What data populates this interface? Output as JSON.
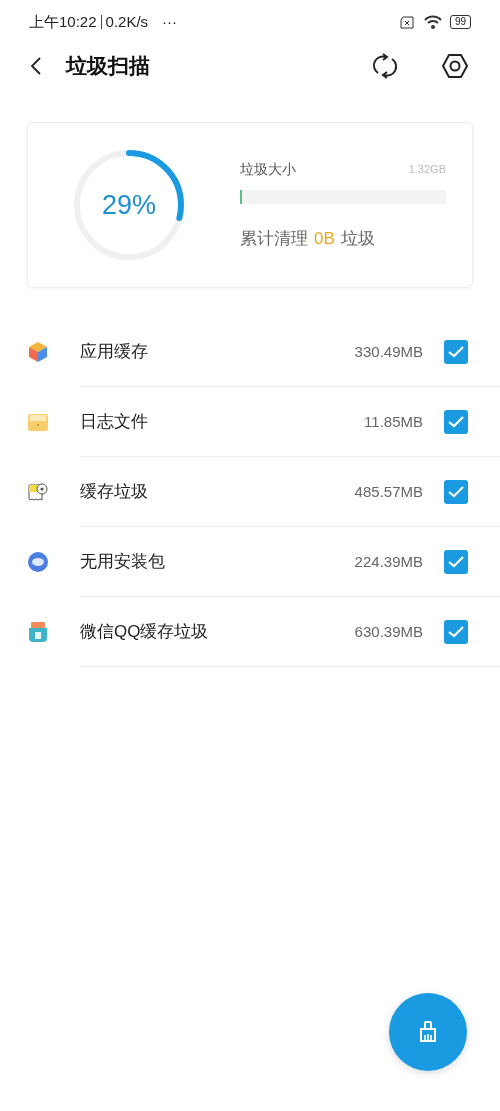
{
  "status_bar": {
    "time": "上午10:22",
    "speed": "0.2K/s",
    "more": "···",
    "battery": "99"
  },
  "header": {
    "title": "垃圾扫描"
  },
  "summary": {
    "percent": "29%",
    "level": 0.29,
    "size_label": "垃圾大小",
    "size": "1.32GB",
    "bar": {
      "level": 0.01
    },
    "cleaned_prefix": "累计清理",
    "cleaned": "0B",
    "cleaned_suffix": "垃圾"
  },
  "items": [
    {
      "kind": "app",
      "label": "应用缓存",
      "size": "330.49MB",
      "checked": true
    },
    {
      "kind": "log",
      "label": "日志文件",
      "size": "11.85MB",
      "checked": true
    },
    {
      "kind": "cache",
      "label": "缓存垃圾",
      "size": "485.57MB",
      "checked": true
    },
    {
      "kind": "apk",
      "label": "无用安装包",
      "size": "224.39MB",
      "checked": true
    },
    {
      "kind": "chat",
      "label": "微信QQ缓存垃圾",
      "size": "630.39MB",
      "checked": true
    }
  ]
}
